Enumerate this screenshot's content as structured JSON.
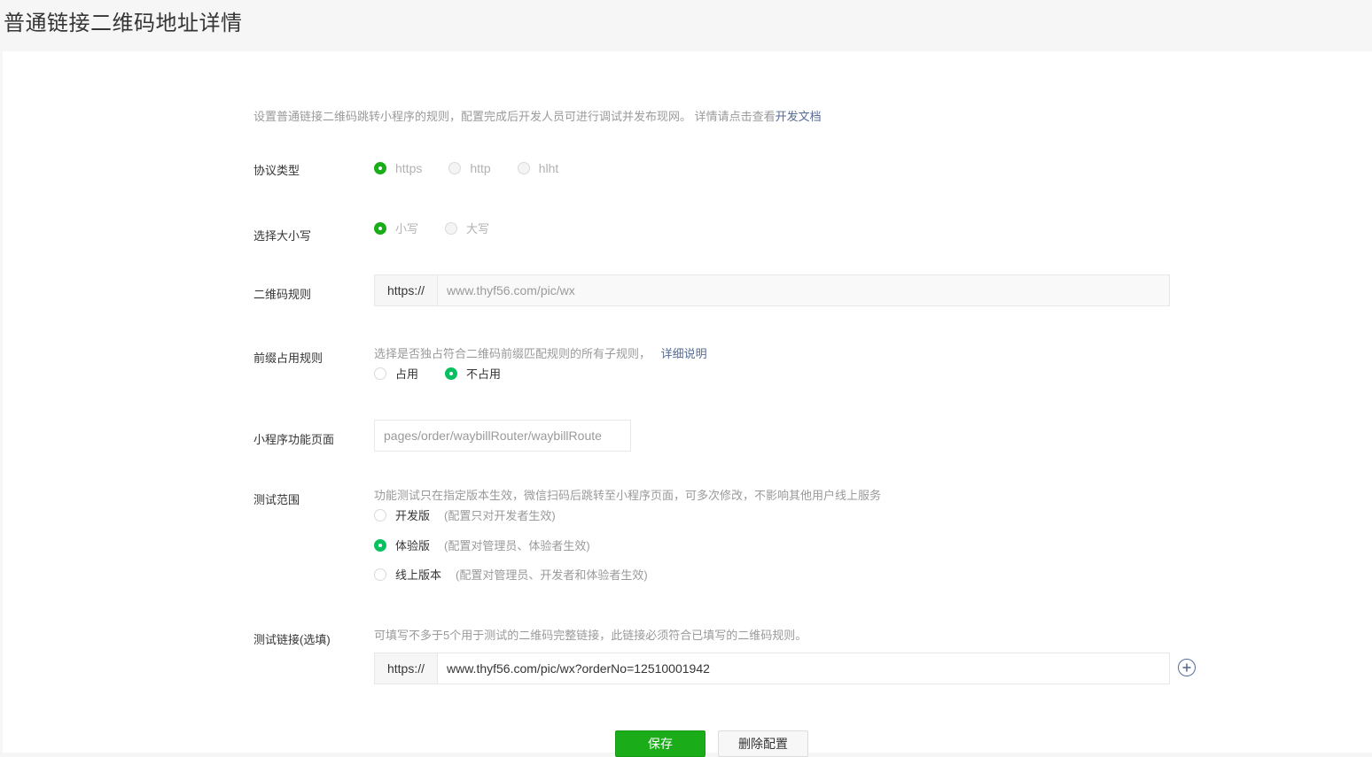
{
  "header": {
    "title": "普通链接二维码地址详情"
  },
  "intro": {
    "text": "设置普通链接二维码跳转小程序的规则，配置完成后开发人员可进行调试并发布现网。 详情请点击查看",
    "link": "开发文档"
  },
  "protocol": {
    "label": "协议类型",
    "options": [
      {
        "label": "https",
        "selected": true
      },
      {
        "label": "http",
        "selected": false
      },
      {
        "label": "hlht",
        "selected": false
      }
    ]
  },
  "case": {
    "label": "选择大小写",
    "options": [
      {
        "label": "小写",
        "selected": true
      },
      {
        "label": "大写",
        "selected": false
      }
    ]
  },
  "qr_rule": {
    "label": "二维码规则",
    "prefix": "https://",
    "value": "www.thyf56.com/pic/wx"
  },
  "prefix_rule": {
    "label": "前缀占用规则",
    "hint": "选择是否独占符合二维码前缀匹配规则的所有子规则，",
    "hint_link": "详细说明",
    "options": [
      {
        "label": "占用",
        "selected": false
      },
      {
        "label": "不占用",
        "selected": true
      }
    ]
  },
  "mini_page": {
    "label": "小程序功能页面",
    "value": "pages/order/waybillRouter/waybillRoute"
  },
  "test_scope": {
    "label": "测试范围",
    "hint": "功能测试只在指定版本生效，微信扫码后跳转至小程序页面，可多次修改，不影响其他用户线上服务",
    "options": [
      {
        "label": "开发版",
        "note": "(配置只对开发者生效)",
        "selected": false
      },
      {
        "label": "体验版",
        "note": "(配置对管理员、体验者生效)",
        "selected": true
      },
      {
        "label": "线上版本",
        "note": "(配置对管理员、开发者和体验者生效)",
        "selected": false
      }
    ]
  },
  "test_link": {
    "label": "测试链接(选填)",
    "hint": "可填写不多于5个用于测试的二维码完整链接，此链接必须符合已填写的二维码规则。",
    "prefix": "https://",
    "value": "www.thyf56.com/pic/wx?orderNo=12510001942",
    "add_icon": "plus-circle-icon"
  },
  "actions": {
    "save": "保存",
    "delete": "删除配置"
  },
  "colors": {
    "accent": "#1aad19",
    "link": "#576b95",
    "radio_on": "#07c160"
  }
}
